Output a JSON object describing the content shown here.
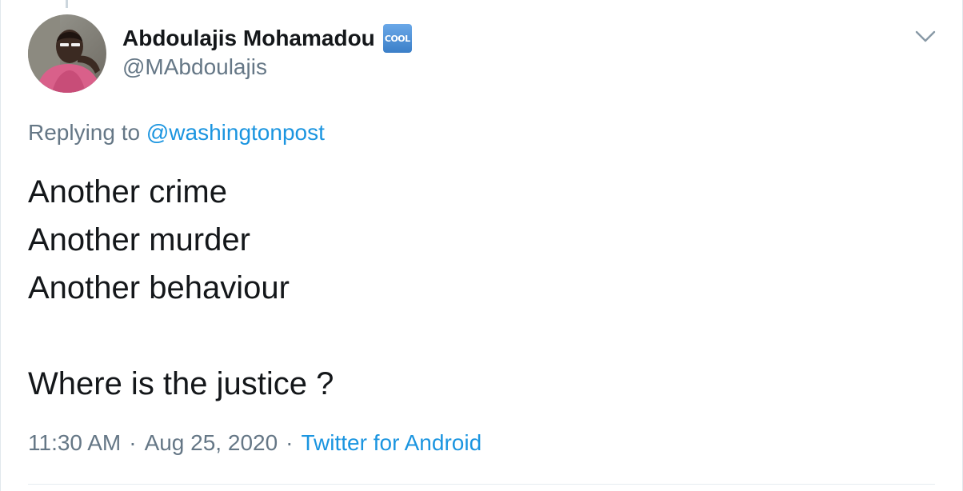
{
  "author": {
    "display_name": "Abdoulajis Mohamadou",
    "badge_emoji": "COOL",
    "handle": "@MAbdoulajis",
    "avatar_icon": "profile-photo"
  },
  "reply": {
    "prefix": "Replying to",
    "mention": "@washingtonpost"
  },
  "tweet": {
    "lines": [
      "Another crime",
      "Another murder",
      "Another behaviour",
      "Where is the justice ?"
    ]
  },
  "meta": {
    "time": "11:30 AM",
    "date": "Aug 25, 2020",
    "source": "Twitter for Android",
    "separator": "·"
  },
  "colors": {
    "link": "#1b95e0",
    "text": "#14171a",
    "secondary": "#657786",
    "badge": "#4a90d9"
  }
}
